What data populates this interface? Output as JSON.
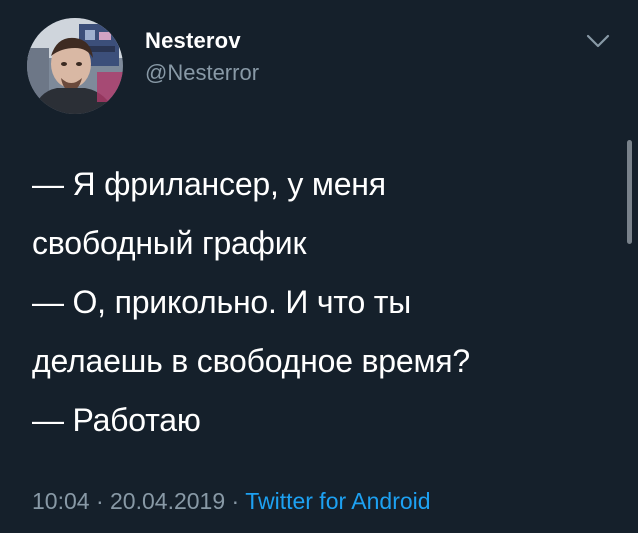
{
  "user": {
    "display_name": "Nesterov",
    "handle": "@Nesterror"
  },
  "tweet": {
    "lines": [
      "— Я фрилансер, у меня",
      "свободный график",
      "— О, прикольно. И что ты",
      "делаешь в свободное время?",
      "— Работаю"
    ],
    "time": "10:04",
    "separator": "·",
    "date": "20.04.2019",
    "source": "Twitter for Android"
  },
  "icons": {
    "menu": "chevron-down-icon",
    "avatar": "avatar"
  },
  "colors": {
    "background": "#15202b",
    "text": "#ffffff",
    "secondary": "#8899a6",
    "link": "#1da1f2"
  }
}
